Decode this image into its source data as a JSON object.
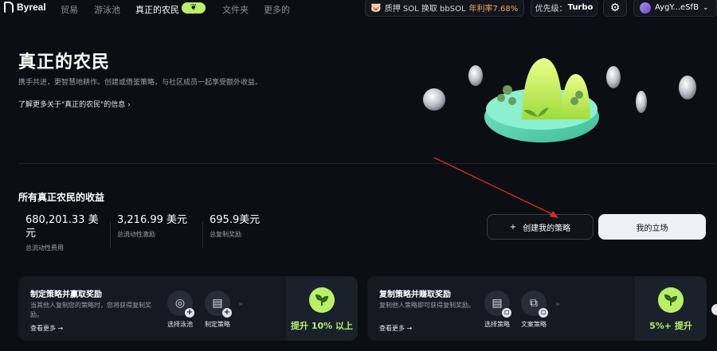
{
  "nav": {
    "brand": "Byreal",
    "items": [
      "贸易",
      "游泳池",
      "真正的农民",
      "文件夹",
      "更多的"
    ],
    "stake_text": "质押 SOL 换取 bbSOL",
    "stake_apy": "年利率7.68%",
    "priority_label": "优先级：",
    "priority_value": "Turbo",
    "wallet": "AygY...eSfB"
  },
  "hero": {
    "title": "真正的农民",
    "description": "携手共进，更智慧地耕作。创建或借鉴策略，与社区成员一起享受额外收益。",
    "learn_more": "了解更多关于\"真正的农民\"的信息"
  },
  "earnings": {
    "title": "所有真正农民的收益",
    "stats": [
      {
        "value": "680,201.33 美元",
        "label": "总流动性费用"
      },
      {
        "value": "3,216.99 美元",
        "label": "总流动性激励"
      },
      {
        "value": "695.9美元",
        "label": "总复制奖励"
      }
    ]
  },
  "actions": {
    "create": "创建我的策略",
    "position": "我的立场"
  },
  "cards": [
    {
      "title": "制定策略并赢取奖励",
      "desc": "当其他人复制您的策略时，您将获得复制奖励。",
      "more": "查看更多",
      "steps": [
        "选择泳池",
        "制定策略"
      ],
      "reward": "提升 10% 以上"
    },
    {
      "title": "复制策略并赚取奖励",
      "desc": "复制他人策略即可获得复制奖励。",
      "more": "查看更多",
      "steps": [
        "选择策略",
        "文案策略"
      ],
      "reward": "5%+ 提升"
    }
  ],
  "colors": {
    "accent": "#b8f06a",
    "apy": "#f2a65a",
    "background": "#0b0e13"
  }
}
